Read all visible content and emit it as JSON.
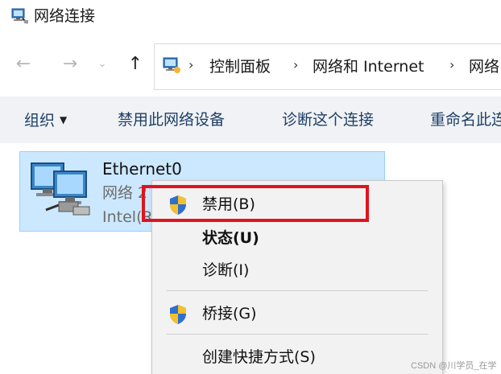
{
  "window": {
    "title": "网络连接",
    "icon": "network-connections-icon"
  },
  "nav": {
    "back_icon": "←",
    "forward_icon": "→",
    "recent_icon": "⌄",
    "up_icon": "↑"
  },
  "address": {
    "separator": "›",
    "segments": [
      "控制面板",
      "网络和 Internet",
      "网络"
    ]
  },
  "toolbar": {
    "organize": "组织",
    "disable_device": "禁用此网络设备",
    "diagnose": "诊断这个连接",
    "rename": "重命名此连"
  },
  "adapter": {
    "name": "Ethernet0",
    "status": "网络 2",
    "device": "Intel(R"
  },
  "context_menu": {
    "items": [
      {
        "label": "禁用(B)",
        "icon": "uac-shield-icon",
        "bold": false
      },
      {
        "label": "状态(U)",
        "bold": true
      },
      {
        "label": "诊断(I)",
        "bold": false
      },
      {
        "label": "桥接(G)",
        "icon": "uac-shield-icon",
        "bold": false
      },
      {
        "label": "创建快捷方式(S)",
        "bold": false
      }
    ]
  },
  "colors": {
    "highlight_box": "#e0141e",
    "selection_bg": "#cce8ff",
    "command_text": "#1e3f66"
  },
  "watermark": "CSDN @川学员_在学"
}
